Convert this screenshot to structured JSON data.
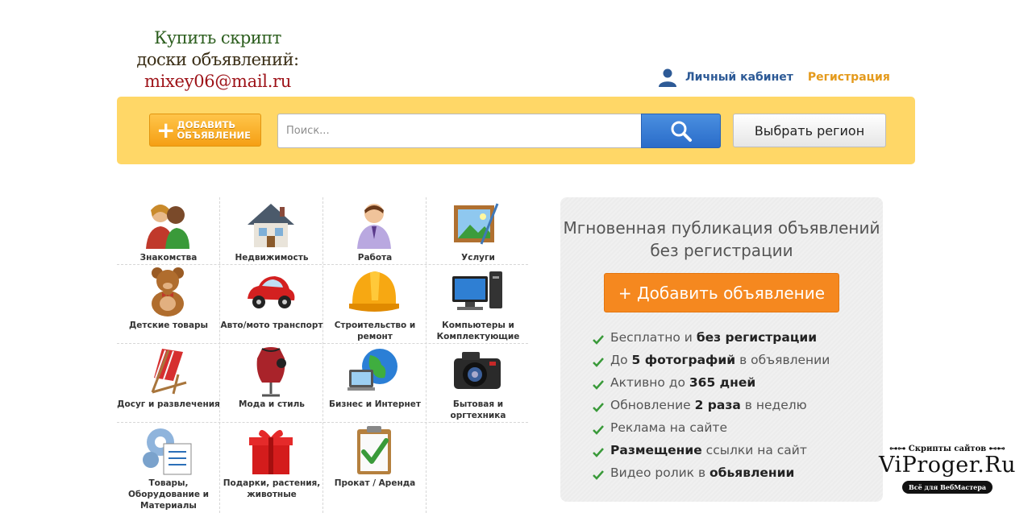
{
  "header": {
    "logo_lines": [
      "Купить скрипт",
      "доски объявлений:",
      "mixey06@mail.ru"
    ],
    "cabinet_label": "Личный кабинет",
    "register_label": "Регистрация"
  },
  "searchbar": {
    "add_line1": "ДОБАВИТЬ",
    "add_line2": "ОБЪЯВЛЕНИЕ",
    "search_placeholder": "Поиск...",
    "region_label": "Выбрать регион"
  },
  "categories": [
    {
      "label": "Знакомства",
      "icon": "people-icon"
    },
    {
      "label": "Недвижимость",
      "icon": "house-icon"
    },
    {
      "label": "Работа",
      "icon": "worker-icon"
    },
    {
      "label": "Услуги",
      "icon": "painting-icon"
    },
    {
      "label": "Детские товары",
      "icon": "teddy-bear-icon"
    },
    {
      "label": "Авто/мото транспорт",
      "icon": "car-icon"
    },
    {
      "label": "Строительство и ремонт",
      "icon": "hard-hat-icon"
    },
    {
      "label": "Компьютеры и Комплектующие",
      "icon": "computer-icon"
    },
    {
      "label": "Досуг и развлечения",
      "icon": "beach-chair-icon"
    },
    {
      "label": "Мода и стиль",
      "icon": "mannequin-icon"
    },
    {
      "label": "Бизнес и Интернет",
      "icon": "globe-icon"
    },
    {
      "label": "Бытовая и оргтехника",
      "icon": "camera-icon"
    },
    {
      "label": "Товары, Оборудование и Материалы",
      "icon": "gears-icon"
    },
    {
      "label": "Подарки, растения, животные",
      "icon": "gift-icon"
    },
    {
      "label": "Прокат / Аренда",
      "icon": "clipboard-icon"
    }
  ],
  "panel": {
    "title_line1": "Мгновенная публикация объявлений",
    "title_line2": "без регистрации",
    "cta_label": "+ Добавить объявление",
    "features": [
      {
        "pre": "Бесплатно и ",
        "bold": "без регистрации",
        "post": ""
      },
      {
        "pre": "До ",
        "bold": "5 фотографий",
        "post": " в объявлении"
      },
      {
        "pre": "Активно до ",
        "bold": "365 дней",
        "post": ""
      },
      {
        "pre": "Обновление ",
        "bold": "2 раза",
        "post": " в неделю"
      },
      {
        "pre": "Реклама на сайте",
        "bold": "",
        "post": ""
      },
      {
        "pre": "",
        "bold": "Размещение",
        "post": " ссылки на сайт"
      },
      {
        "pre": "Видео ролик в ",
        "bold": "обьявлении",
        "post": ""
      }
    ]
  },
  "watermark": {
    "top": "Скрипты сайтов",
    "main": "ViProger.Ru",
    "sub": "Всё для ВебМастера"
  },
  "colors": {
    "searchbar_bg": "#ffd767",
    "cta_orange": "#f5881f",
    "link_blue": "#2d5a96",
    "register_orange": "#e49a1c",
    "search_blue": "#2a6cc9"
  }
}
